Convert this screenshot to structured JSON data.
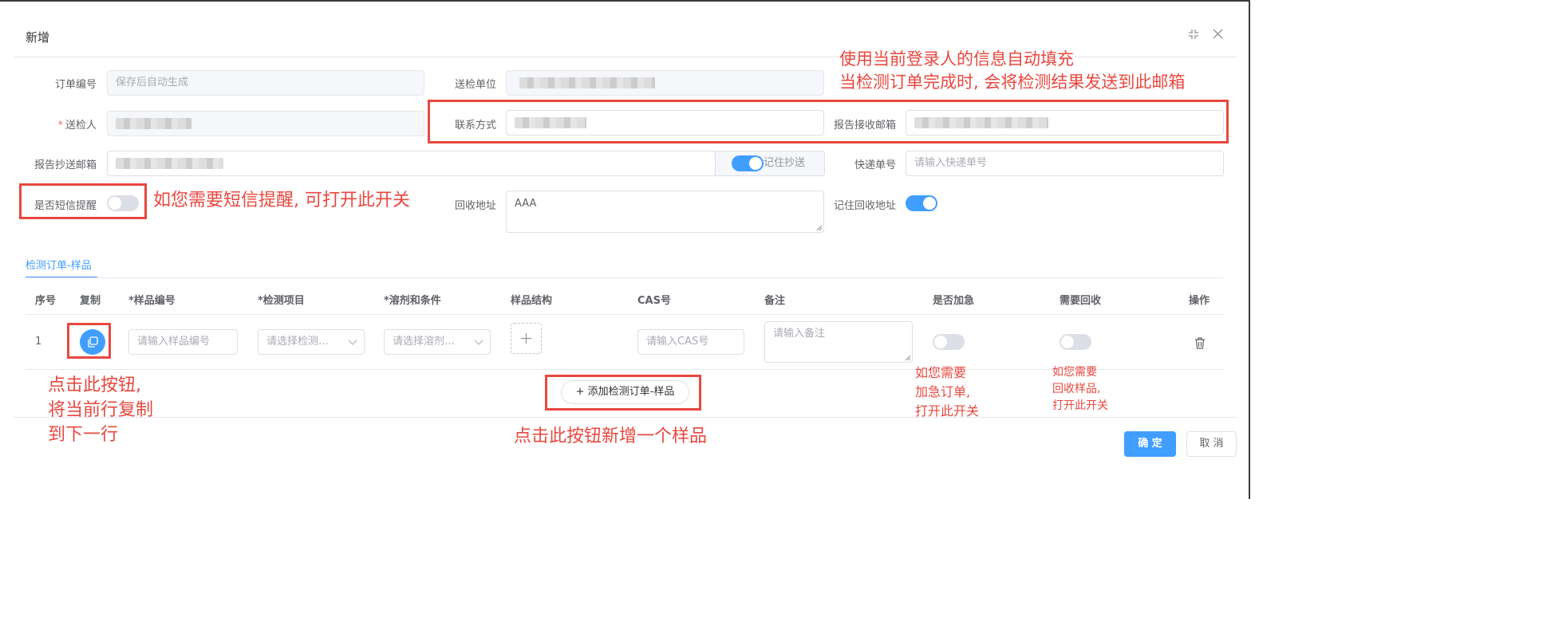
{
  "dialog": {
    "title": "新增"
  },
  "form": {
    "order_no": {
      "label": "订单编号",
      "placeholder": "保存后自动生成"
    },
    "unit": {
      "label": "送检单位",
      "value_prefix": ""
    },
    "sender": {
      "label": "送检人",
      "required_mark": "*"
    },
    "contact": {
      "label": "联系方式"
    },
    "report_email": {
      "label": "报告接收邮箱"
    },
    "cc_email": {
      "label": "报告抄送邮箱",
      "remember_label": "记住抄送"
    },
    "express": {
      "label": "快递单号",
      "placeholder": "请输入快递单号"
    },
    "sms": {
      "label": "是否短信提醒"
    },
    "address": {
      "label": "回收地址",
      "value": "AAA",
      "remember_label": "记住回收地址"
    }
  },
  "tabs": [
    {
      "label": "检测订单-样品"
    }
  ],
  "table": {
    "headers": [
      "序号",
      "复制",
      "*样品编号",
      "*检测项目",
      "*溶剂和条件",
      "样品结构",
      "CAS号",
      "备注",
      "是否加急",
      "需要回收",
      "操作"
    ],
    "rows": [
      {
        "index": "1",
        "sample_no_placeholder": "请输入样品编号",
        "test_item_placeholder": "请选择检测…",
        "solvent_placeholder": "请选择溶剂…",
        "cas_placeholder": "请输入CAS号",
        "remark_placeholder": "请输入备注",
        "urgent": false,
        "recycle": false
      }
    ],
    "add_button": "+ 添加检测订单-样品"
  },
  "footer": {
    "confirm": "确 定",
    "cancel": "取 消"
  },
  "annotations": {
    "top_line1": "使用当前登录人的信息自动填充",
    "top_line2": "当检测订单完成时, 会将检测结果发送到此邮箱",
    "sms": "如您需要短信提醒, 可打开此开关",
    "copy_line1": "点击此按钮,",
    "copy_line2": "将当前行复制",
    "copy_line3": "到下一行",
    "add": "点击此按钮新增一个样品",
    "urgent_line1": "如您需要",
    "urgent_line2": "加急订单,",
    "urgent_line3": "打开此开关",
    "recycle_line1": "如您需要",
    "recycle_line2": "回收样品,",
    "recycle_line3": "打开此开关"
  },
  "colors": {
    "primary": "#409eff",
    "annotation": "#e8483f"
  }
}
